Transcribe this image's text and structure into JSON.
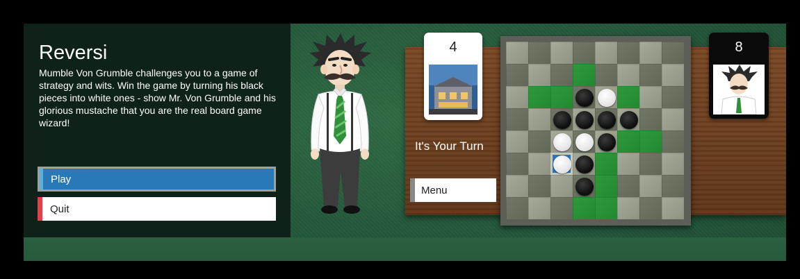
{
  "game": {
    "title": "Reversi",
    "description": "Mumble Von Grumble challenges you to a game of strategy and wits. Win the game by turning his black pieces into white ones - show Mr. Von Grumble and his glorious mustache that you are the real board game wizard!"
  },
  "menu": {
    "play_label": "Play",
    "quit_label": "Quit",
    "ingame_menu_label": "Menu"
  },
  "status": {
    "turn_text": "It's Your Turn"
  },
  "scores": {
    "player": "4",
    "opponent": "8"
  },
  "colors": {
    "play_button": "#2979b9",
    "quit_accent": "#e0404c",
    "valid_move": "#2e9a3c",
    "selected_cell": "#2d74b8"
  },
  "board": {
    "rows": [
      [
        "",
        "",
        "",
        "",
        "",
        "",
        "",
        ""
      ],
      [
        "",
        "",
        "",
        "",
        "",
        "",
        "",
        ""
      ],
      [
        "",
        "",
        "",
        "B",
        "W",
        "",
        "",
        ""
      ],
      [
        "",
        "",
        "B",
        "B",
        "B",
        "B",
        "",
        ""
      ],
      [
        "",
        "",
        "W",
        "W",
        "B",
        "",
        "",
        ""
      ],
      [
        "",
        "",
        "W",
        "B",
        "",
        "",
        "",
        ""
      ],
      [
        "",
        "",
        "",
        "B",
        "",
        "",
        "",
        ""
      ],
      [
        "",
        "",
        "",
        "",
        "",
        "",
        "",
        ""
      ]
    ],
    "valid_moves": [
      [
        1,
        3
      ],
      [
        2,
        1
      ],
      [
        2,
        2
      ],
      [
        2,
        5
      ],
      [
        4,
        5
      ],
      [
        4,
        6
      ],
      [
        5,
        4
      ],
      [
        6,
        4
      ],
      [
        7,
        3
      ],
      [
        7,
        4
      ]
    ],
    "selected": [
      5,
      2
    ]
  }
}
